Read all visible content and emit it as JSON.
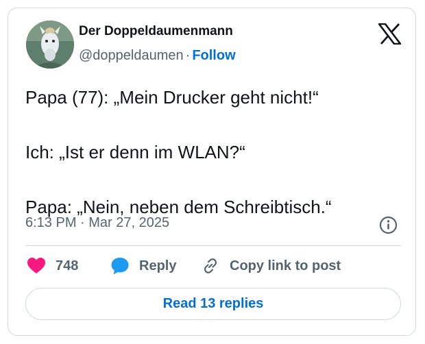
{
  "author": {
    "name": "Der Doppeldaumenmann",
    "handle": "@doppeldaumen",
    "separator": "·",
    "follow_label": "Follow"
  },
  "logo_icon": "x-logo-icon",
  "tweet": {
    "lines": [
      "Papa (77): „Mein Drucker geht nicht!“",
      "Ich: „Ist er denn im WLAN?“",
      "Papa: „Nein, neben dem Schreibtisch.“"
    ],
    "timestamp": "6:13 PM · Mar 27, 2025"
  },
  "actions": {
    "like_count": "748",
    "reply_label": "Reply",
    "copy_label": "Copy link to post"
  },
  "read_replies_label": "Read 13 replies",
  "colors": {
    "like": "#f91880",
    "reply": "#1d9bf0",
    "link": "#006fd6",
    "border": "#cfd9de",
    "muted": "#536471"
  }
}
